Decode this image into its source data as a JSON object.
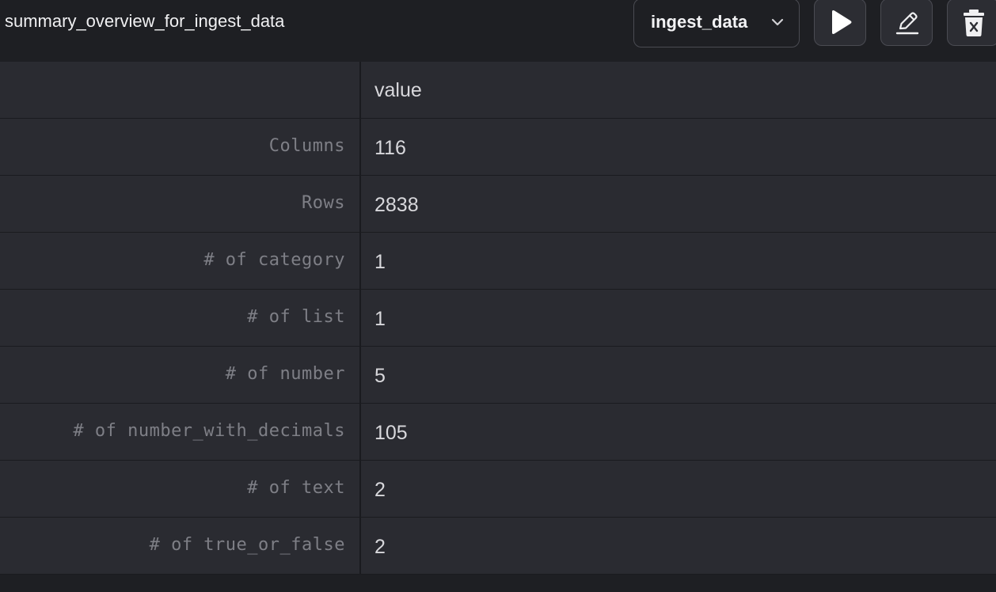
{
  "header": {
    "title": "summary_overview_for_ingest_data",
    "dataset_select": {
      "selected": "ingest_data",
      "icon": "chevron-down-icon"
    },
    "buttons": {
      "run": {
        "icon": "play-icon"
      },
      "edit": {
        "icon": "pencil-icon"
      },
      "delete": {
        "icon": "trash-icon"
      }
    }
  },
  "table": {
    "columns": [
      "",
      "value"
    ],
    "rows": [
      {
        "label": "Columns",
        "value": "116"
      },
      {
        "label": "Rows",
        "value": "2838"
      },
      {
        "label": "# of category",
        "value": "1"
      },
      {
        "label": "# of list",
        "value": "1"
      },
      {
        "label": "# of number",
        "value": "5"
      },
      {
        "label": "# of number_with_decimals",
        "value": "105"
      },
      {
        "label": "# of text",
        "value": "2"
      },
      {
        "label": "# of true_or_false",
        "value": "2"
      }
    ]
  },
  "colors": {
    "background": "#1e1f23",
    "table_background": "#2a2b31",
    "label_text": "#7e7f86",
    "value_text": "#d8d8dc"
  }
}
